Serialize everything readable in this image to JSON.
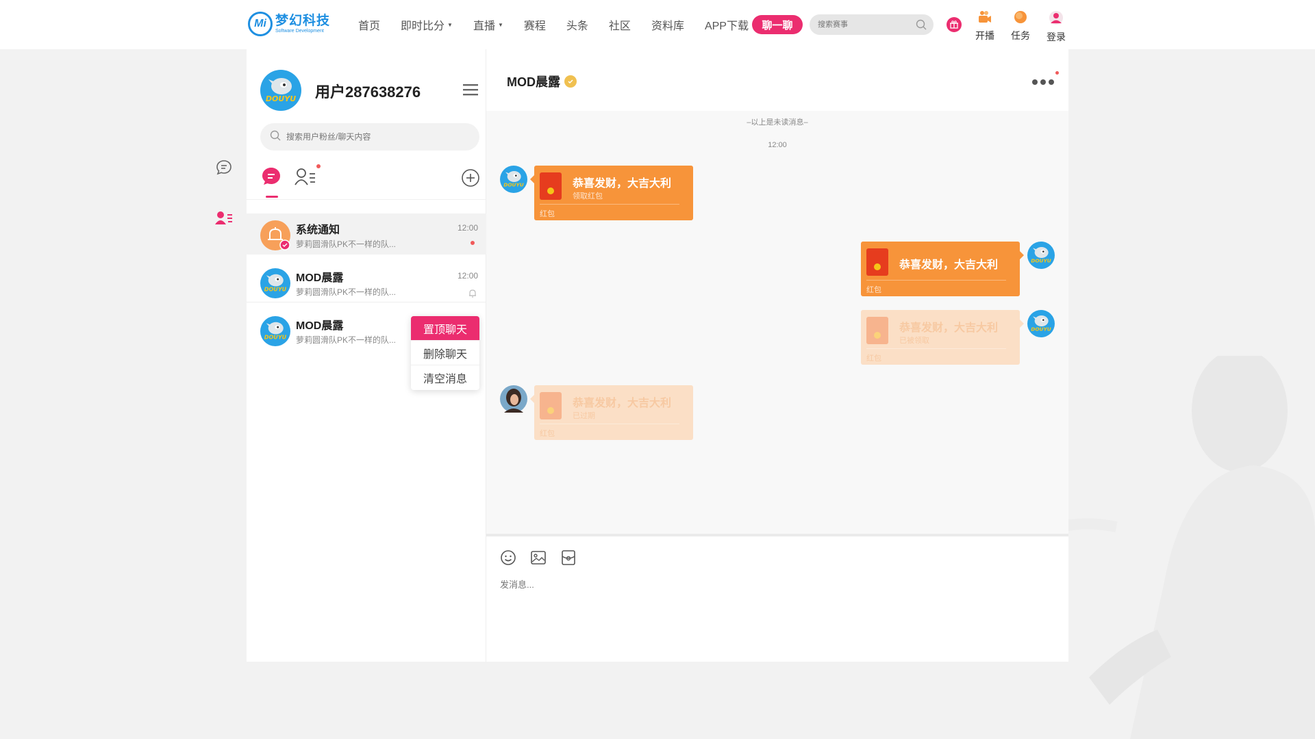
{
  "brand": {
    "mark": "Mi",
    "name_cn": "梦幻科技",
    "name_en": "Software Development"
  },
  "nav": {
    "items": [
      {
        "label": "首页",
        "dropdown": false
      },
      {
        "label": "即时比分",
        "dropdown": true
      },
      {
        "label": "直播",
        "dropdown": true
      },
      {
        "label": "赛程",
        "dropdown": false
      },
      {
        "label": "头条",
        "dropdown": false
      },
      {
        "label": "社区",
        "dropdown": false
      },
      {
        "label": "资料库",
        "dropdown": false
      },
      {
        "label": "APP下载",
        "dropdown": false
      }
    ],
    "chat_button": "聊一聊",
    "search_placeholder": "搜索赛事",
    "tools": {
      "live": "开播",
      "task": "任务",
      "login": "登录"
    }
  },
  "sidebar_icons": [
    "chat-bubble-icon",
    "contacts-icon"
  ],
  "me": {
    "avatar_text": "DOUYU",
    "username": "用户287638276",
    "search_placeholder": "搜索用户粉丝/聊天内容"
  },
  "conversations": [
    {
      "name": "系统通知",
      "preview": "萝莉圆滑队PK不一样的队...",
      "time": "12:00",
      "unread_dot": true,
      "muted": false,
      "active": true,
      "avatar": "system-bell"
    },
    {
      "name": "MOD晨露",
      "preview": "萝莉圆滑队PK不一样的队...",
      "time": "12:00",
      "unread_dot": false,
      "muted": true,
      "active": false,
      "avatar": "douyu"
    },
    {
      "name": "MOD晨露",
      "preview": "萝莉圆滑队PK不一样的队...",
      "time": "",
      "unread_dot": false,
      "muted": false,
      "active": false,
      "avatar": "douyu"
    }
  ],
  "context_menu": [
    "置顶聊天",
    "删除聊天",
    "清空消息"
  ],
  "chat": {
    "title": "MOD晨露",
    "unread_divider": "–以上是未读消息–",
    "timestamp": "12:00",
    "messages": [
      {
        "side": "left",
        "title": "恭喜发财，大吉大利",
        "sub": "领取红包",
        "foot": "红包",
        "faded": false,
        "avatar": "douyu"
      },
      {
        "side": "right",
        "title": "恭喜发财，大吉大利",
        "sub": "",
        "foot": "红包",
        "faded": false,
        "avatar": "douyu"
      },
      {
        "side": "right",
        "title": "恭喜发财，大吉大利",
        "sub": "已被领取",
        "foot": "红包",
        "faded": true,
        "avatar": "douyu"
      },
      {
        "side": "left",
        "title": "恭喜发财，大吉大利",
        "sub": "已过期",
        "foot": "红包",
        "faded": true,
        "avatar": "photo"
      }
    ],
    "composer_placeholder": "发消息..."
  },
  "colors": {
    "accent": "#eb2d6f",
    "brand_blue": "#1e8fe1",
    "red_packet": "#f7943a",
    "red_packet_faded": "#fbdfc6"
  }
}
